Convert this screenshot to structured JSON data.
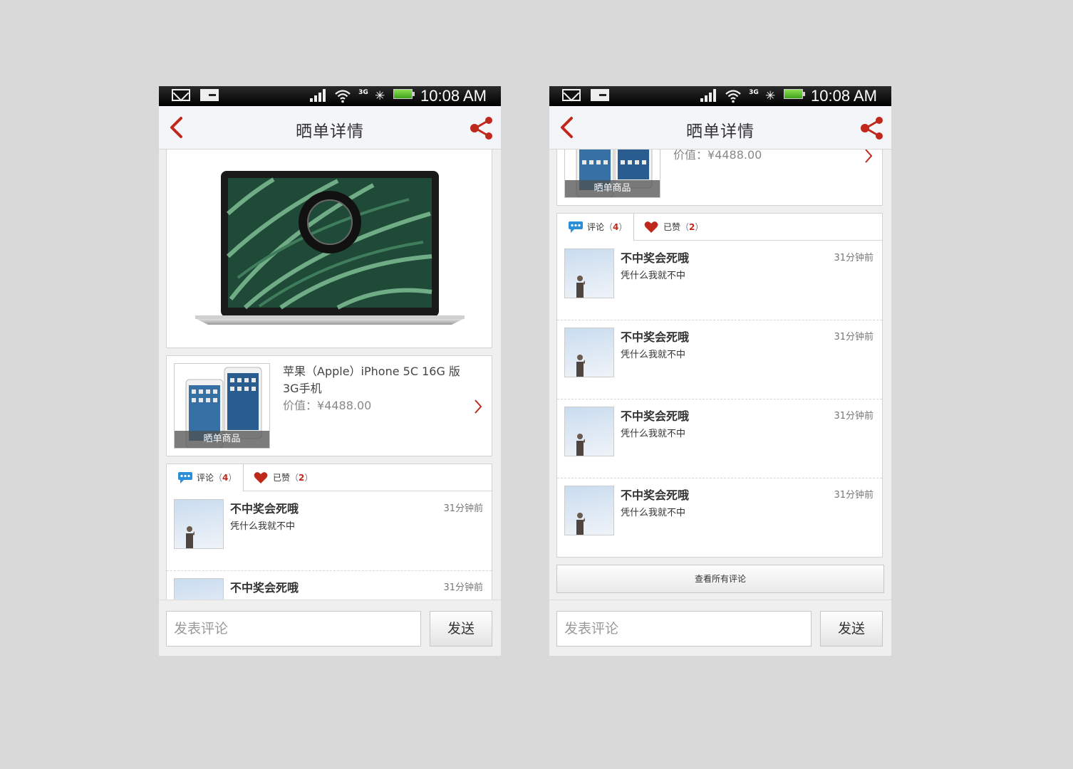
{
  "status_bar": {
    "time": "10:08 AM",
    "network": "3G"
  },
  "header": {
    "title": "晒单详情"
  },
  "product": {
    "name": "苹果（Apple）iPhone 5C 16G 版 3G手机",
    "price_label": "价值：",
    "price": "¥4488.00",
    "thumb_label": "晒单商品"
  },
  "tabs": {
    "comments": {
      "label": "评论",
      "count": "4"
    },
    "likes": {
      "label": "已赞",
      "count": "2"
    }
  },
  "comments": [
    {
      "user": "不中奖会死哦",
      "time": "31分钟前",
      "text": "凭什么我就不中"
    },
    {
      "user": "不中奖会死哦",
      "time": "31分钟前",
      "text": "凭什么我就不中"
    },
    {
      "user": "不中奖会死哦",
      "time": "31分钟前",
      "text": "凭什么我就不中"
    },
    {
      "user": "不中奖会死哦",
      "time": "31分钟前",
      "text": "凭什么我就不中"
    }
  ],
  "view_all_label": "查看所有评论",
  "composer": {
    "placeholder": "发表评论",
    "send_label": "发送"
  },
  "colors": {
    "accent": "#c0281c",
    "bubble": "#2a8fd6"
  }
}
